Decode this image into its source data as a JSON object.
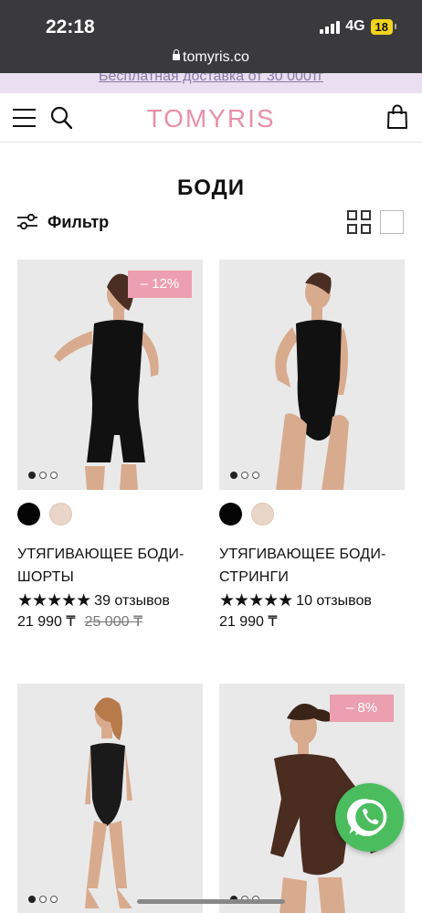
{
  "status_bar": {
    "time": "22:18",
    "network": "4G",
    "battery": "18",
    "url": "tomyris.co"
  },
  "promo": {
    "text": "Бесплатная доставка от 30 000тг"
  },
  "header": {
    "logo": "TOMYRIS"
  },
  "page": {
    "title": "БОДИ"
  },
  "toolbar": {
    "filter_label": "Фильтр"
  },
  "products": [
    {
      "badge": "– 12%",
      "title": "УТЯГИВАЮЩЕЕ БОДИ-ШОРТЫ",
      "rating_stars": "★★★★★",
      "reviews": "39 отзывов",
      "price": "21 990 ₸",
      "old_price": "25 000 ₸",
      "colors": [
        "#050505",
        "#ead6c9"
      ]
    },
    {
      "badge": "",
      "title": "УТЯГИВАЮЩЕЕ БОДИ-СТРИНГИ",
      "rating_stars": "★★★★★",
      "reviews": "10 отзывов",
      "price": "21 990 ₸",
      "old_price": "",
      "colors": [
        "#050505",
        "#ead6c9"
      ]
    },
    {
      "badge": "",
      "title": "",
      "rating_stars": "",
      "reviews": "",
      "price": "",
      "old_price": "",
      "colors": []
    },
    {
      "badge": "– 8%",
      "title": "",
      "rating_stars": "",
      "reviews": "",
      "price": "",
      "old_price": "",
      "colors": []
    }
  ],
  "icons": {
    "menu": "menu-icon",
    "search": "search-icon",
    "cart": "shopping-bag-icon",
    "filter": "sliders-icon",
    "grid_view": "grid-view-icon",
    "single_view": "single-view-icon",
    "chat": "whatsapp-icon"
  },
  "colors": {
    "brand": "#e890a6",
    "badge": "#ec9fb1",
    "promo_bg": "#e9dff0",
    "whatsapp": "#4bbd5e"
  }
}
